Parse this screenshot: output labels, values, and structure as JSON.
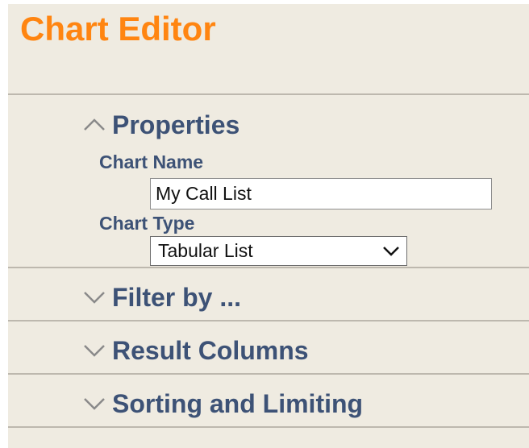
{
  "editor": {
    "title": "Chart Editor"
  },
  "sections": {
    "properties": {
      "label": "Properties",
      "expanded": true,
      "icon": "chevron-up-icon",
      "chart_name_label": "Chart Name",
      "chart_name_value": "My Call List",
      "chart_type_label": "Chart Type",
      "chart_type_value": "Tabular List",
      "chart_type_icon": "chevron-down-icon"
    },
    "filter": {
      "label": "Filter by ...",
      "expanded": false,
      "icon": "chevron-down-icon"
    },
    "result_columns": {
      "label": "Result Columns",
      "expanded": false,
      "icon": "chevron-down-icon"
    },
    "sorting": {
      "label": "Sorting and Limiting",
      "expanded": false,
      "icon": "chevron-down-icon"
    }
  },
  "colors": {
    "panel_background": "#efebe1",
    "title": "#ff8511",
    "section_text": "#3d5276",
    "divider": "#bdb8ae",
    "chevron": "#8a8a8a"
  }
}
